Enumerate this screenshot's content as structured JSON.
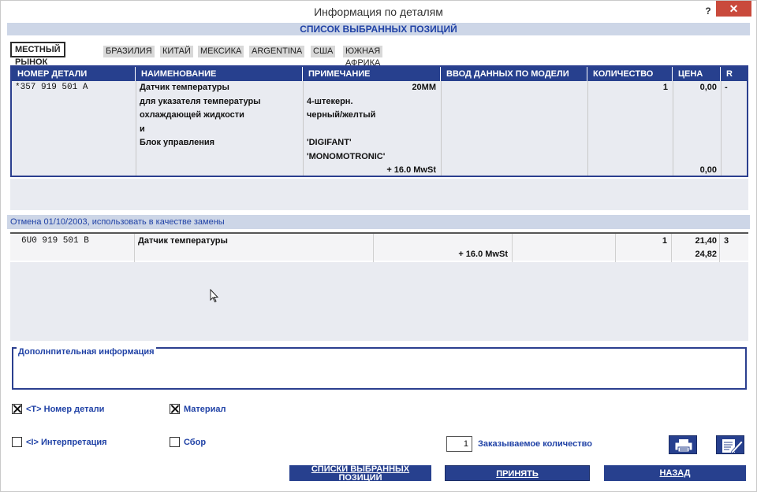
{
  "window": {
    "title": "Информация по деталям",
    "help_label": "?",
    "close_label": "✕"
  },
  "list_header": "СПИСОК ВЫБРАННЫХ ПОЗИЦИЙ",
  "tabs": [
    {
      "label": "МЕСТНЫЙ РЫНОК",
      "active": true
    },
    {
      "label": "БРАЗИЛИЯ",
      "active": false
    },
    {
      "label": "КИТАЙ",
      "active": false
    },
    {
      "label": "МЕКСИКА",
      "active": false
    },
    {
      "label": "ARGENTINA",
      "active": false
    },
    {
      "label": "США",
      "active": false
    },
    {
      "label": "ЮЖНАЯ АФРИКА",
      "active": false
    }
  ],
  "columns": {
    "part_no": "НОМЕР ДЕТАЛИ",
    "name": "НАИМЕНОВАНИЕ",
    "note": "ПРИМЕЧАНИЕ",
    "model_input": "ВВОД ДАННЫХ ПО МОДЕЛИ",
    "qty": "КОЛИЧЕСТВО",
    "price": "ЦЕНА",
    "r": "R"
  },
  "main_row": {
    "part_no": "*357 919 501 A",
    "name_lines": [
      "Датчик температуры",
      "для указателя температуры",
      "охлаждающей жидкости",
      "и",
      "Блок управления"
    ],
    "note_right": "20MM",
    "note_lines": [
      "4-штекерн.",
      "черный/желтый",
      "",
      "'DIGIFANT'",
      "'MONOMOTRONIC'"
    ],
    "tax": "+  16.0 MwSt",
    "qty": "1",
    "price": "0,00",
    "price_total": "0,00",
    "r": "-"
  },
  "replacement_bar": "Отмена 01/10/2003, использовать в качестве замены",
  "replacement_row": {
    "part_no": "6U0 919 501 B",
    "name": "Датчик температуры",
    "tax": "+  16.0 MwSt",
    "qty": "1",
    "price": "21,40",
    "price_total": "24,82",
    "r": "3"
  },
  "additional_info_label": "Дополнпительная  информация",
  "options": {
    "part_no_label": "<T> Номер детали",
    "part_no_checked": true,
    "material_label": "Материал",
    "material_checked": true,
    "interpretation_label": "<I> Интерпретация",
    "interpretation_checked": false,
    "assembly_label": "Сбор",
    "assembly_checked": false
  },
  "order_qty": {
    "value": "1",
    "label": "Заказываемое количество"
  },
  "icons": {
    "print": "printer-icon",
    "edit": "edit-notepad-icon"
  },
  "buttons": {
    "lists": "СПИСКИ ВЫБРАННЫХ ПОЗИЦИЙ",
    "accept": "ПРИНЯТЬ",
    "back": "НАЗАД"
  },
  "colors": {
    "accent": "#27408e",
    "header_bg": "#cdd6e7",
    "header_text": "#2042a6",
    "close": "#c94a3c"
  }
}
